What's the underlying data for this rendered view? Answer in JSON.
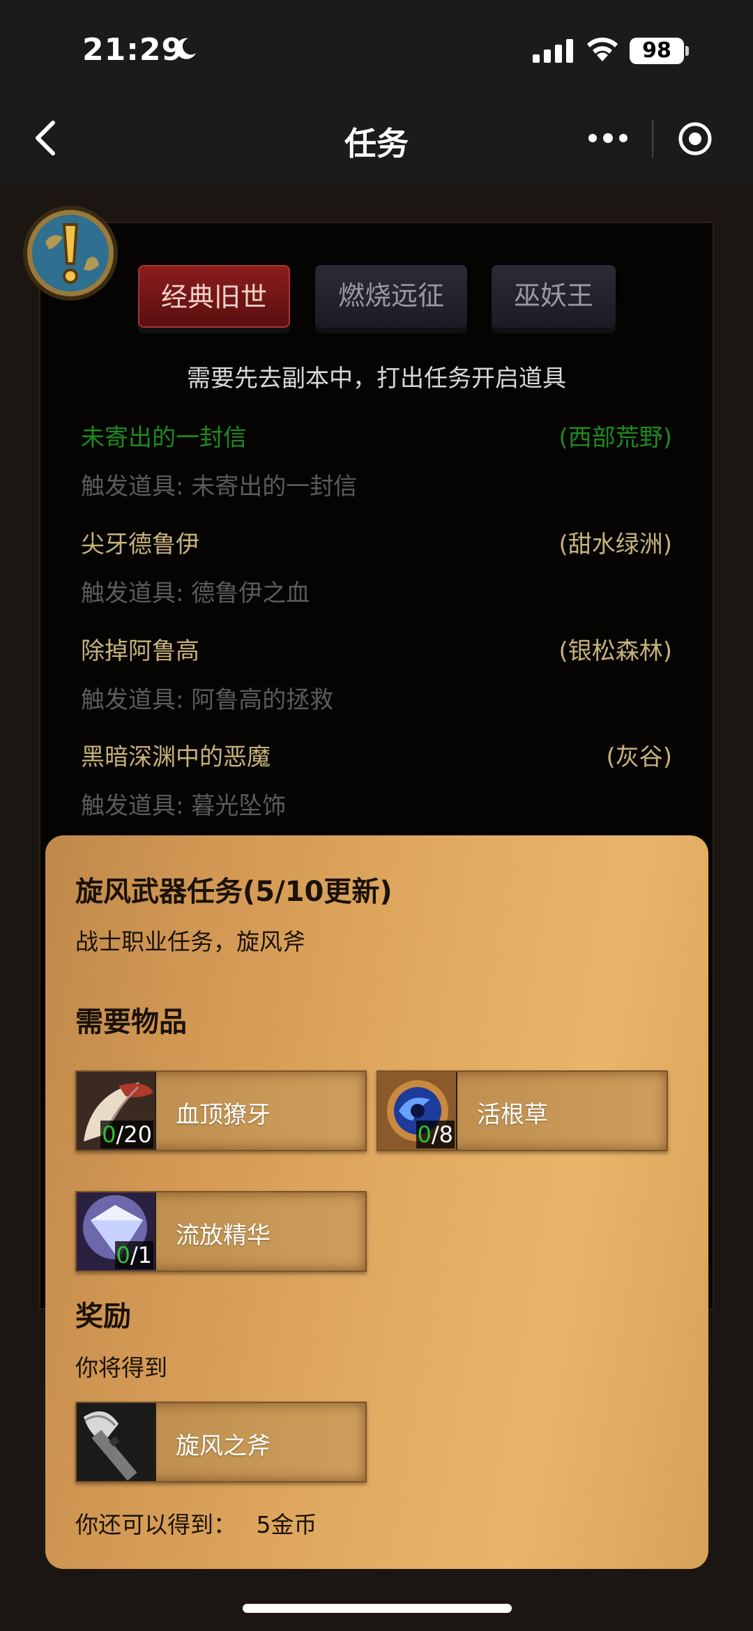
{
  "status": {
    "time": "21:29",
    "battery": "98"
  },
  "nav": {
    "title": "任务"
  },
  "tabs": [
    {
      "label": "经典旧世",
      "active": true
    },
    {
      "label": "燃烧远征",
      "active": false
    },
    {
      "label": "巫妖王",
      "active": false
    }
  ],
  "hint": "需要先去副本中，打出任务开启道具",
  "quests": [
    {
      "name": "未寄出的一封信",
      "zone": "(西部荒野)",
      "item": "触发道具: 未寄出的一封信",
      "color": "#1f8a1f"
    },
    {
      "name": "尖牙德鲁伊",
      "zone": "(甜水绿洲)",
      "item": "触发道具: 德鲁伊之血",
      "color": "#c7b27a"
    },
    {
      "name": "除掉阿鲁高",
      "zone": "(银松森林)",
      "item": "触发道具: 阿鲁高的拯救",
      "color": "#c7b27a"
    },
    {
      "name": "黑暗深渊中的恶魔",
      "zone": "(灰谷)",
      "item": "触发道具: 暮光坠饰",
      "color": "#c7b27a"
    }
  ],
  "card": {
    "title": "旋风武器任务(5/10更新)",
    "subtitle": "战士职业任务，旋风斧",
    "required_heading": "需要物品",
    "required_items": [
      {
        "name": "血顶獠牙",
        "have": "0",
        "need": "/20",
        "icon": "fang-icon"
      },
      {
        "name": "活根草",
        "have": "0",
        "need": "/8",
        "icon": "liferoot-icon"
      },
      {
        "name": "流放精华",
        "have": "0",
        "need": "/1",
        "icon": "essence-icon"
      }
    ],
    "reward_heading": "奖励",
    "reward_sub": "你将得到",
    "reward_item": {
      "name": "旋风之斧",
      "icon": "axe-icon"
    },
    "extra_label": "你还可以得到：",
    "extra_value": "5金币"
  }
}
